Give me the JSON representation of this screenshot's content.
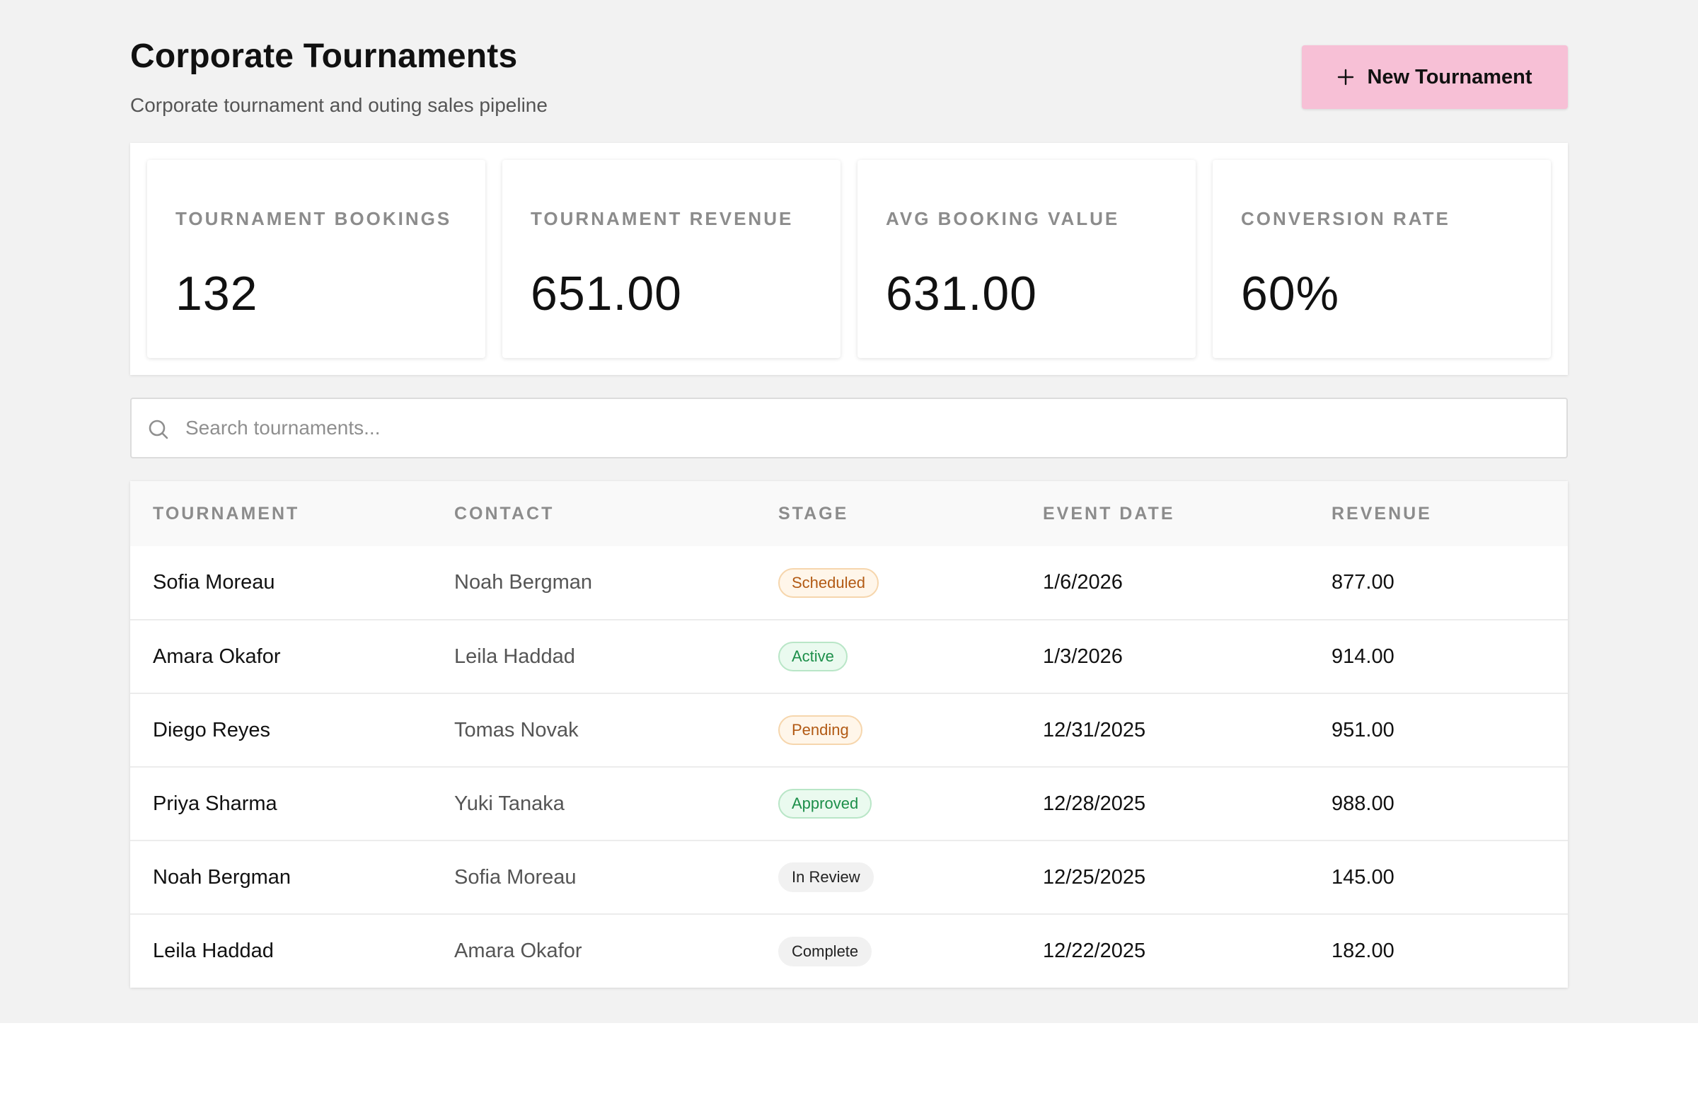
{
  "header": {
    "title": "Corporate Tournaments",
    "subtitle": "Corporate tournament and outing sales pipeline",
    "new_button_label": "New Tournament"
  },
  "stats": [
    {
      "label": "TOURNAMENT BOOKINGS",
      "value": "132"
    },
    {
      "label": "TOURNAMENT REVENUE",
      "value": "651.00"
    },
    {
      "label": "AVG BOOKING VALUE",
      "value": "631.00"
    },
    {
      "label": "CONVERSION RATE",
      "value": "60%"
    }
  ],
  "search": {
    "placeholder": "Search tournaments...",
    "value": ""
  },
  "table": {
    "columns": [
      "TOURNAMENT",
      "CONTACT",
      "STAGE",
      "EVENT DATE",
      "REVENUE"
    ],
    "rows": [
      {
        "tournament": "Sofia Moreau",
        "contact": "Noah Bergman",
        "stage": "Scheduled",
        "date": "1/6/2026",
        "revenue": "877.00"
      },
      {
        "tournament": "Amara Okafor",
        "contact": "Leila Haddad",
        "stage": "Active",
        "date": "1/3/2026",
        "revenue": "914.00"
      },
      {
        "tournament": "Diego Reyes",
        "contact": "Tomas Novak",
        "stage": "Pending",
        "date": "12/31/2025",
        "revenue": "951.00"
      },
      {
        "tournament": "Priya Sharma",
        "contact": "Yuki Tanaka",
        "stage": "Approved",
        "date": "12/28/2025",
        "revenue": "988.00"
      },
      {
        "tournament": "Noah Bergman",
        "contact": "Sofia Moreau",
        "stage": "In Review",
        "date": "12/25/2025",
        "revenue": "145.00"
      },
      {
        "tournament": "Leila Haddad",
        "contact": "Amara Okafor",
        "stage": "Complete",
        "date": "12/22/2025",
        "revenue": "182.00"
      }
    ]
  },
  "colors": {
    "accent_button": "#f7c0d6",
    "badge_amber_text": "#b25a14",
    "badge_green_text": "#1d8f4a",
    "page_background": "#f2f2f2"
  }
}
